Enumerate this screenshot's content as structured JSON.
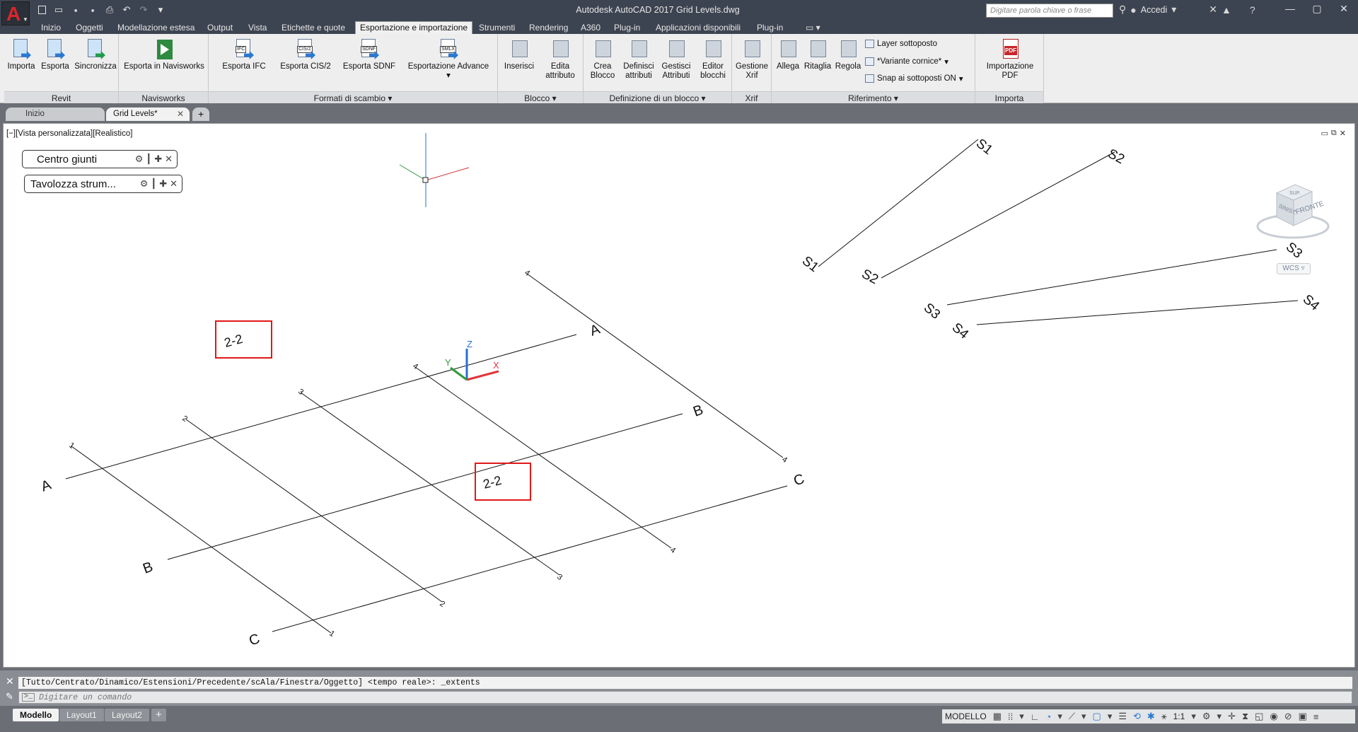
{
  "titlebar": {
    "app_logo": "A",
    "window_title": "Autodesk AutoCAD 2017    Grid Levels.dwg",
    "search_placeholder": "Digitare parola chiave o frase",
    "signin_label": "Accedi",
    "icons": [
      "new-icon",
      "open-icon",
      "save-icon",
      "save-as-icon",
      "plot-icon",
      "undo-icon",
      "redo-icon"
    ]
  },
  "ribbon_tabs": [
    "Inizio",
    "Oggetti",
    "Modellazione estesa",
    "Output",
    "Vista",
    "Etichette e quote",
    "Esportazione e importazione",
    "Strumenti",
    "Rendering",
    "A360",
    "Plug-in",
    "Applicazioni disponibili",
    "Plug-in"
  ],
  "active_tab": "Esportazione e importazione",
  "ribbon": {
    "revit": {
      "title": "Revit",
      "buttons": [
        "Importa",
        "Esporta",
        "Sincronizza"
      ]
    },
    "navisworks": {
      "title": "Navisworks",
      "buttons": [
        "Esporta in Navisworks"
      ]
    },
    "formati": {
      "title": "Formati di scambio",
      "buttons": [
        "Esporta IFC",
        "Esporta CIS/2",
        "Esporta SDNF",
        "Esportazione Advance"
      ],
      "icon_tags": [
        "IFC",
        "CIS/2",
        "SDNF",
        "SMLX"
      ]
    },
    "blocco": {
      "title": "Blocco",
      "buttons": [
        "Inserisci",
        "Edita attributo"
      ]
    },
    "definizione": {
      "title": "Definizione di un blocco",
      "buttons": [
        "Crea Blocco",
        "Definisci attributi",
        "Gestisci Attributi",
        "Editor blocchi"
      ]
    },
    "xrif": {
      "title": "Xrif",
      "buttons": [
        "Gestione Xrif"
      ]
    },
    "riferimento": {
      "title": "Riferimento",
      "buttons": [
        "Allega",
        "Ritaglia",
        "Regola"
      ],
      "small": [
        "Layer sottoposto",
        "*Variante cornice*",
        "Snap ai sottoposti ON"
      ]
    },
    "importa": {
      "title": "Importa",
      "buttons": [
        "Importazione PDF"
      ],
      "pdf_tag": "PDF"
    }
  },
  "file_tabs": [
    "Inizio",
    "Grid Levels*"
  ],
  "viewport": {
    "label": "[−][Vista personalizzata][Realistico]",
    "palettes": [
      "Centro giunti",
      "Tavolozza strum..."
    ],
    "viewcube_face": "FRONTE",
    "viewcube_side": "SINIST.",
    "viewcube_top": "SUP.",
    "wcs_label": "WCS",
    "ucs_axes": [
      "X",
      "Y",
      "Z"
    ],
    "grid_labels": {
      "letters": [
        "A",
        "B",
        "C"
      ],
      "numbers": [
        "1",
        "2",
        "3",
        "4"
      ],
      "highlight": "2-2",
      "sections": [
        "S1",
        "S2",
        "S3",
        "S4"
      ]
    }
  },
  "command_line": {
    "history": "[Tutto/Centrato/Dinamico/Estensioni/Precedente/scAla/Finestra/Oggetto] <tempo reale>: _extents",
    "placeholder": "Digitare un comando"
  },
  "status": {
    "layouts": [
      "Modello",
      "Layout1",
      "Layout2"
    ],
    "model_label": "MODELLO",
    "scale": "1:1"
  },
  "colors": {
    "accent": "#2a79d2",
    "highlight_box": "#e01818",
    "axis_x": "#e0353a",
    "axis_y": "#2f9a3a",
    "axis_z": "#2a6fd0"
  }
}
